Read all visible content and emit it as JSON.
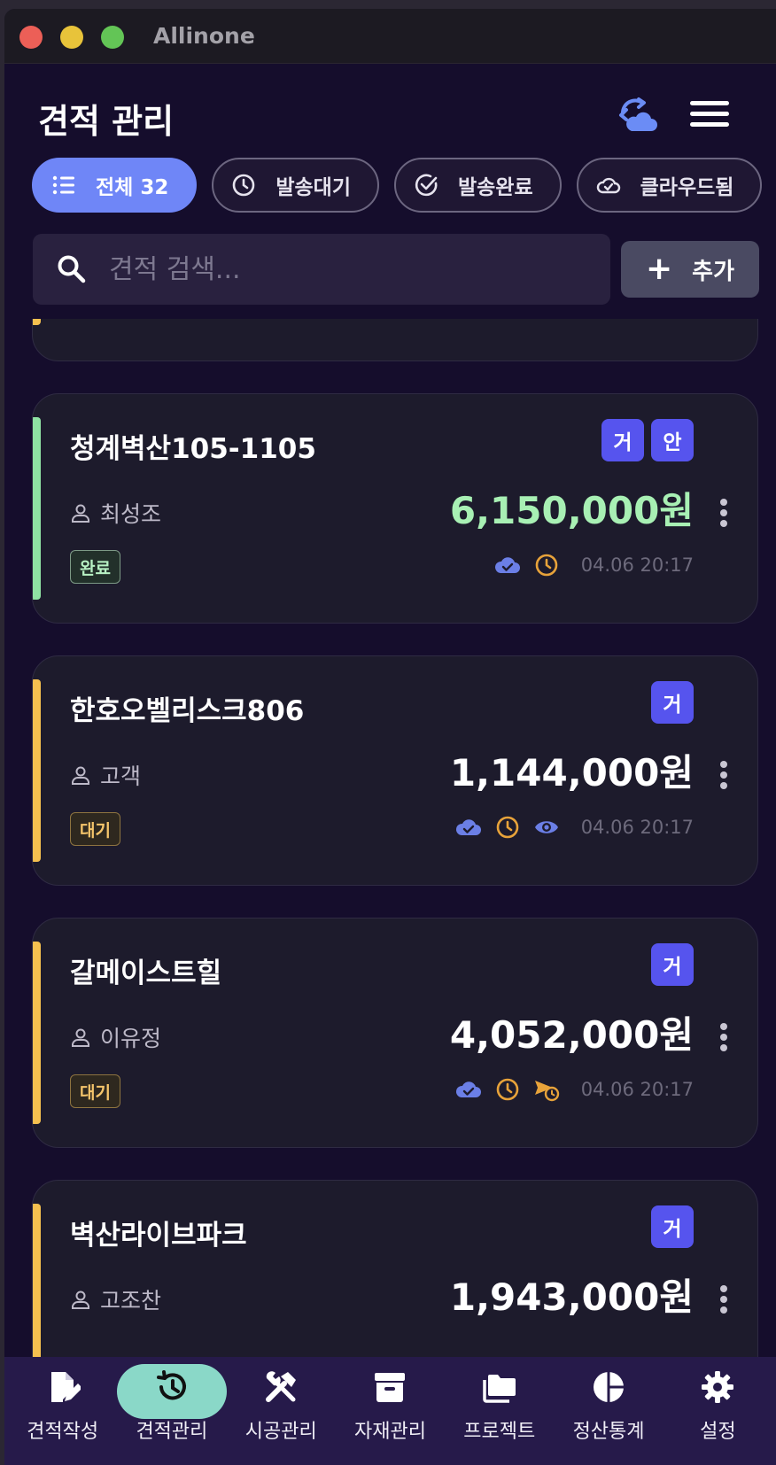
{
  "window": {
    "title": "Allinone"
  },
  "header": {
    "title": "견적 관리"
  },
  "filters": [
    {
      "label": "전체 32",
      "icon": "list-icon",
      "active": true
    },
    {
      "label": "발송대기",
      "icon": "clock-icon",
      "active": false
    },
    {
      "label": "발송완료",
      "icon": "check-circle-icon",
      "active": false
    },
    {
      "label": "클라우드됨",
      "icon": "cloud-check-icon",
      "active": false
    }
  ],
  "search": {
    "placeholder": "견적 검색...",
    "value": ""
  },
  "add_button": {
    "label": "추가"
  },
  "quotes": [
    {
      "name": "청계벽산105-1105",
      "badges": [
        "거",
        "안"
      ],
      "customer": "최성조",
      "amount": "6,150,000원",
      "amount_color": "#a8f0b4",
      "status": "완료",
      "status_type": "done",
      "bar_color": "#8fe3a3",
      "meta_icons": [
        "cloud-check-icon",
        "clock-icon"
      ],
      "time": "04.06 20:17"
    },
    {
      "name": "한호오벨리스크806",
      "badges": [
        "거"
      ],
      "customer": "고객",
      "amount": "1,144,000원",
      "amount_color": "#ffffff",
      "status": "대기",
      "status_type": "wait",
      "bar_color": "#f5c04f",
      "meta_icons": [
        "cloud-check-icon",
        "clock-icon",
        "eye-icon"
      ],
      "time": "04.06 20:17"
    },
    {
      "name": "갈메이스트힐",
      "badges": [
        "거"
      ],
      "customer": "이유정",
      "amount": "4,052,000원",
      "amount_color": "#ffffff",
      "status": "대기",
      "status_type": "wait",
      "bar_color": "#f5c04f",
      "meta_icons": [
        "cloud-check-icon",
        "clock-icon",
        "send-later-icon"
      ],
      "time": "04.06 20:17"
    },
    {
      "name": "벽산라이브파크",
      "badges": [
        "거"
      ],
      "customer": "고조찬",
      "amount": "1,943,000원",
      "amount_color": "#ffffff",
      "status": "",
      "status_type": "wait",
      "bar_color": "#f5c04f",
      "meta_icons": [],
      "time": ""
    }
  ],
  "nav": [
    {
      "label": "견적작성",
      "icon": "edit-document-icon",
      "active": false
    },
    {
      "label": "견적관리",
      "icon": "history-icon",
      "active": true
    },
    {
      "label": "시공관리",
      "icon": "tools-icon",
      "active": false
    },
    {
      "label": "자재관리",
      "icon": "archive-box-icon",
      "active": false
    },
    {
      "label": "프로젝트",
      "icon": "folders-icon",
      "active": false
    },
    {
      "label": "정산통계",
      "icon": "pie-chart-icon",
      "active": false
    },
    {
      "label": "설정",
      "icon": "gear-icon",
      "active": false
    }
  ],
  "colors": {
    "accent": "#6f86f7",
    "badge": "#5654ee",
    "nav_active": "#8ad8c8",
    "pending": "#f5c04f",
    "done": "#8fe3a3"
  }
}
